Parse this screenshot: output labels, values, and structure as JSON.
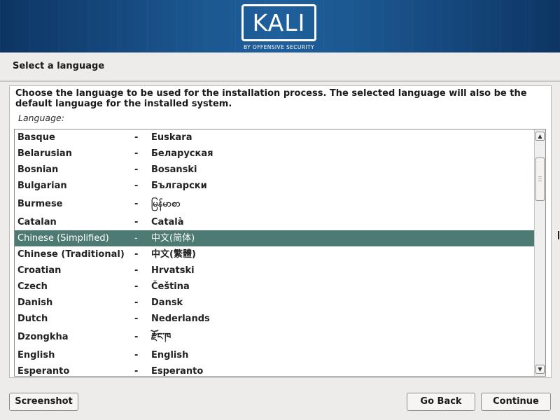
{
  "header": {
    "logo_text": "KALI",
    "logo_subtitle": "BY OFFENSIVE SECURITY"
  },
  "page": {
    "title": "Select a language",
    "description": "Choose the language to be used for the installation process. The selected language will also be the default language for the installed system.",
    "list_label": "Language:"
  },
  "languages": [
    {
      "name": "Basque",
      "native": "Euskara",
      "selected": false
    },
    {
      "name": "Belarusian",
      "native": "Беларуская",
      "selected": false
    },
    {
      "name": "Bosnian",
      "native": "Bosanski",
      "selected": false
    },
    {
      "name": "Bulgarian",
      "native": "Български",
      "selected": false
    },
    {
      "name": "Burmese",
      "native": "မြန်မာစာ",
      "selected": false
    },
    {
      "name": "Catalan",
      "native": "Català",
      "selected": false
    },
    {
      "name": "Chinese (Simplified)",
      "native": "中文(简体)",
      "selected": true
    },
    {
      "name": "Chinese (Traditional)",
      "native": "中文(繁體)",
      "selected": false
    },
    {
      "name": "Croatian",
      "native": "Hrvatski",
      "selected": false
    },
    {
      "name": "Czech",
      "native": "Čeština",
      "selected": false
    },
    {
      "name": "Danish",
      "native": "Dansk",
      "selected": false
    },
    {
      "name": "Dutch",
      "native": "Nederlands",
      "selected": false
    },
    {
      "name": "Dzongkha",
      "native": "རྫོང་ཁ",
      "selected": false
    },
    {
      "name": "English",
      "native": "English",
      "selected": false
    },
    {
      "name": "Esperanto",
      "native": "Esperanto",
      "selected": false
    }
  ],
  "separator": "-",
  "buttons": {
    "screenshot": "Screenshot",
    "go_back": "Go Back",
    "continue": "Continue"
  },
  "colors": {
    "selection": "#4d7a73",
    "banner": "#1b568f"
  }
}
